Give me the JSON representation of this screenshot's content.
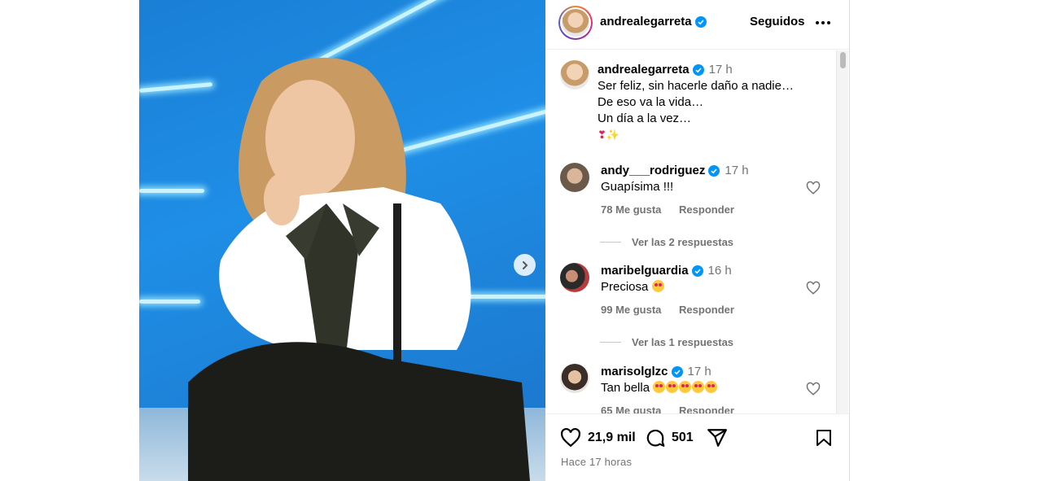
{
  "header": {
    "username": "andrealegarreta",
    "following_label": "Seguidos"
  },
  "caption": {
    "username": "andrealegarreta",
    "time": "17 h",
    "lines": [
      "Ser feliz, sin hacerle daño a nadie…",
      "De eso va la vida…",
      "Un día a la vez…"
    ],
    "emojis": "❣✨"
  },
  "comments": [
    {
      "username": "andy___rodriguez",
      "time": "17 h",
      "text": "Guapísima !!!",
      "likes": "78 Me gusta",
      "reply_label": "Responder",
      "view_replies": "Ver las 2 respuestas"
    },
    {
      "username": "maribelguardia",
      "time": "16 h",
      "text": "Preciosa",
      "likes": "99 Me gusta",
      "reply_label": "Responder",
      "view_replies": "Ver las 1 respuestas"
    },
    {
      "username": "marisolglzc",
      "time": "17 h",
      "text": "Tan bella",
      "likes": "65 Me gusta",
      "reply_label": "Responder"
    }
  ],
  "actions": {
    "likes_count": "21,9 mil",
    "comments_count": "501",
    "posted_ago": "Hace 17 horas"
  },
  "colors": {
    "verified": "#0095f6",
    "secondary_text": "#737373",
    "photo_background": "#1f8ee6"
  },
  "icons": [
    "verified-icon",
    "more-icon",
    "heart-icon",
    "comment-icon",
    "share-icon",
    "bookmark-icon",
    "chevron-right-icon"
  ]
}
